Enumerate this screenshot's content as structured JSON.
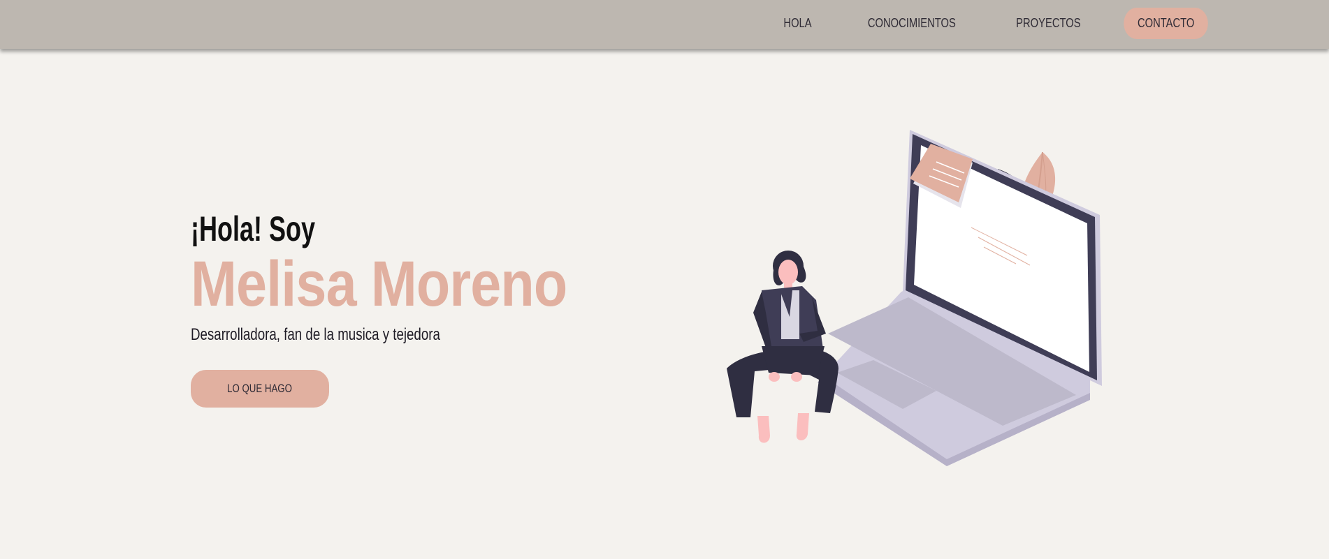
{
  "nav": {
    "items": [
      {
        "label": "HOLA"
      },
      {
        "label": "CONOCIMIENTOS"
      },
      {
        "label": "PROYECTOS"
      },
      {
        "label": "CONTACTO",
        "active": true
      }
    ]
  },
  "hero": {
    "greeting": "¡Hola! Soy",
    "name": "Melisa Moreno",
    "tagline": "Desarrolladora, fan de la musica y tejedora",
    "cta_label": "LO QUE HAGO"
  },
  "colors": {
    "header": "#bdb7b0",
    "background": "#f4f2ee",
    "accent": "#e1b0a0",
    "dark": "#2f2b35"
  },
  "icons": [
    "woman-on-laptop-illustration"
  ]
}
